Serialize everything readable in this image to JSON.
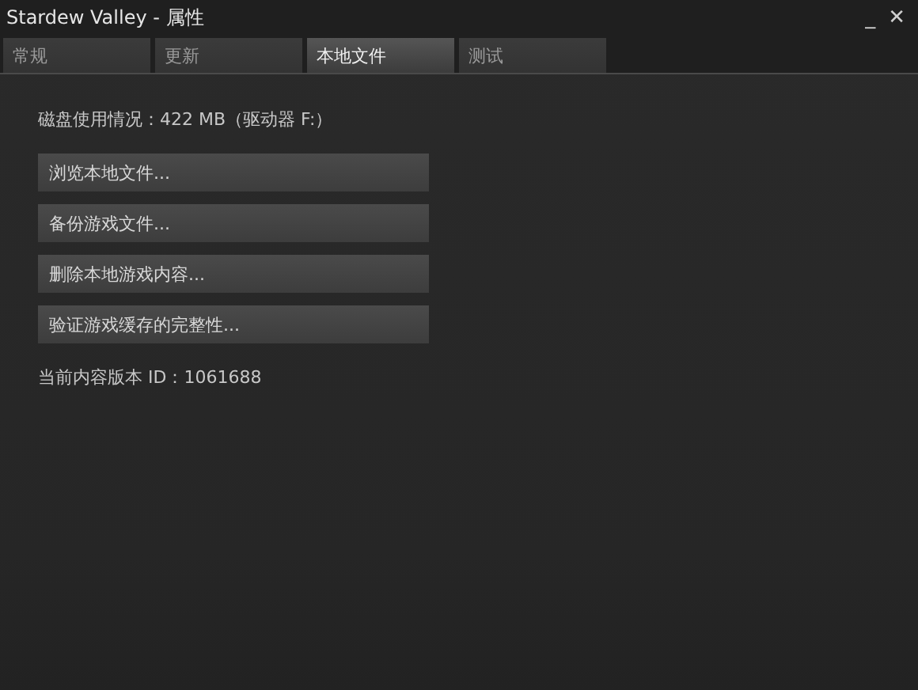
{
  "window": {
    "title": "Stardew Valley - 属性",
    "minimize": "_",
    "close": "✕"
  },
  "tabs": [
    {
      "label": "常规",
      "selected": false
    },
    {
      "label": "更新",
      "selected": false
    },
    {
      "label": "本地文件",
      "selected": true
    },
    {
      "label": "测试",
      "selected": false
    }
  ],
  "disk_usage": "磁盘使用情况：422 MB（驱动器 F:）",
  "buttons": [
    "浏览本地文件...",
    "备份游戏文件...",
    "删除本地游戏内容...",
    "验证游戏缓存的完整性..."
  ],
  "build_id": "当前内容版本 ID：1061688"
}
